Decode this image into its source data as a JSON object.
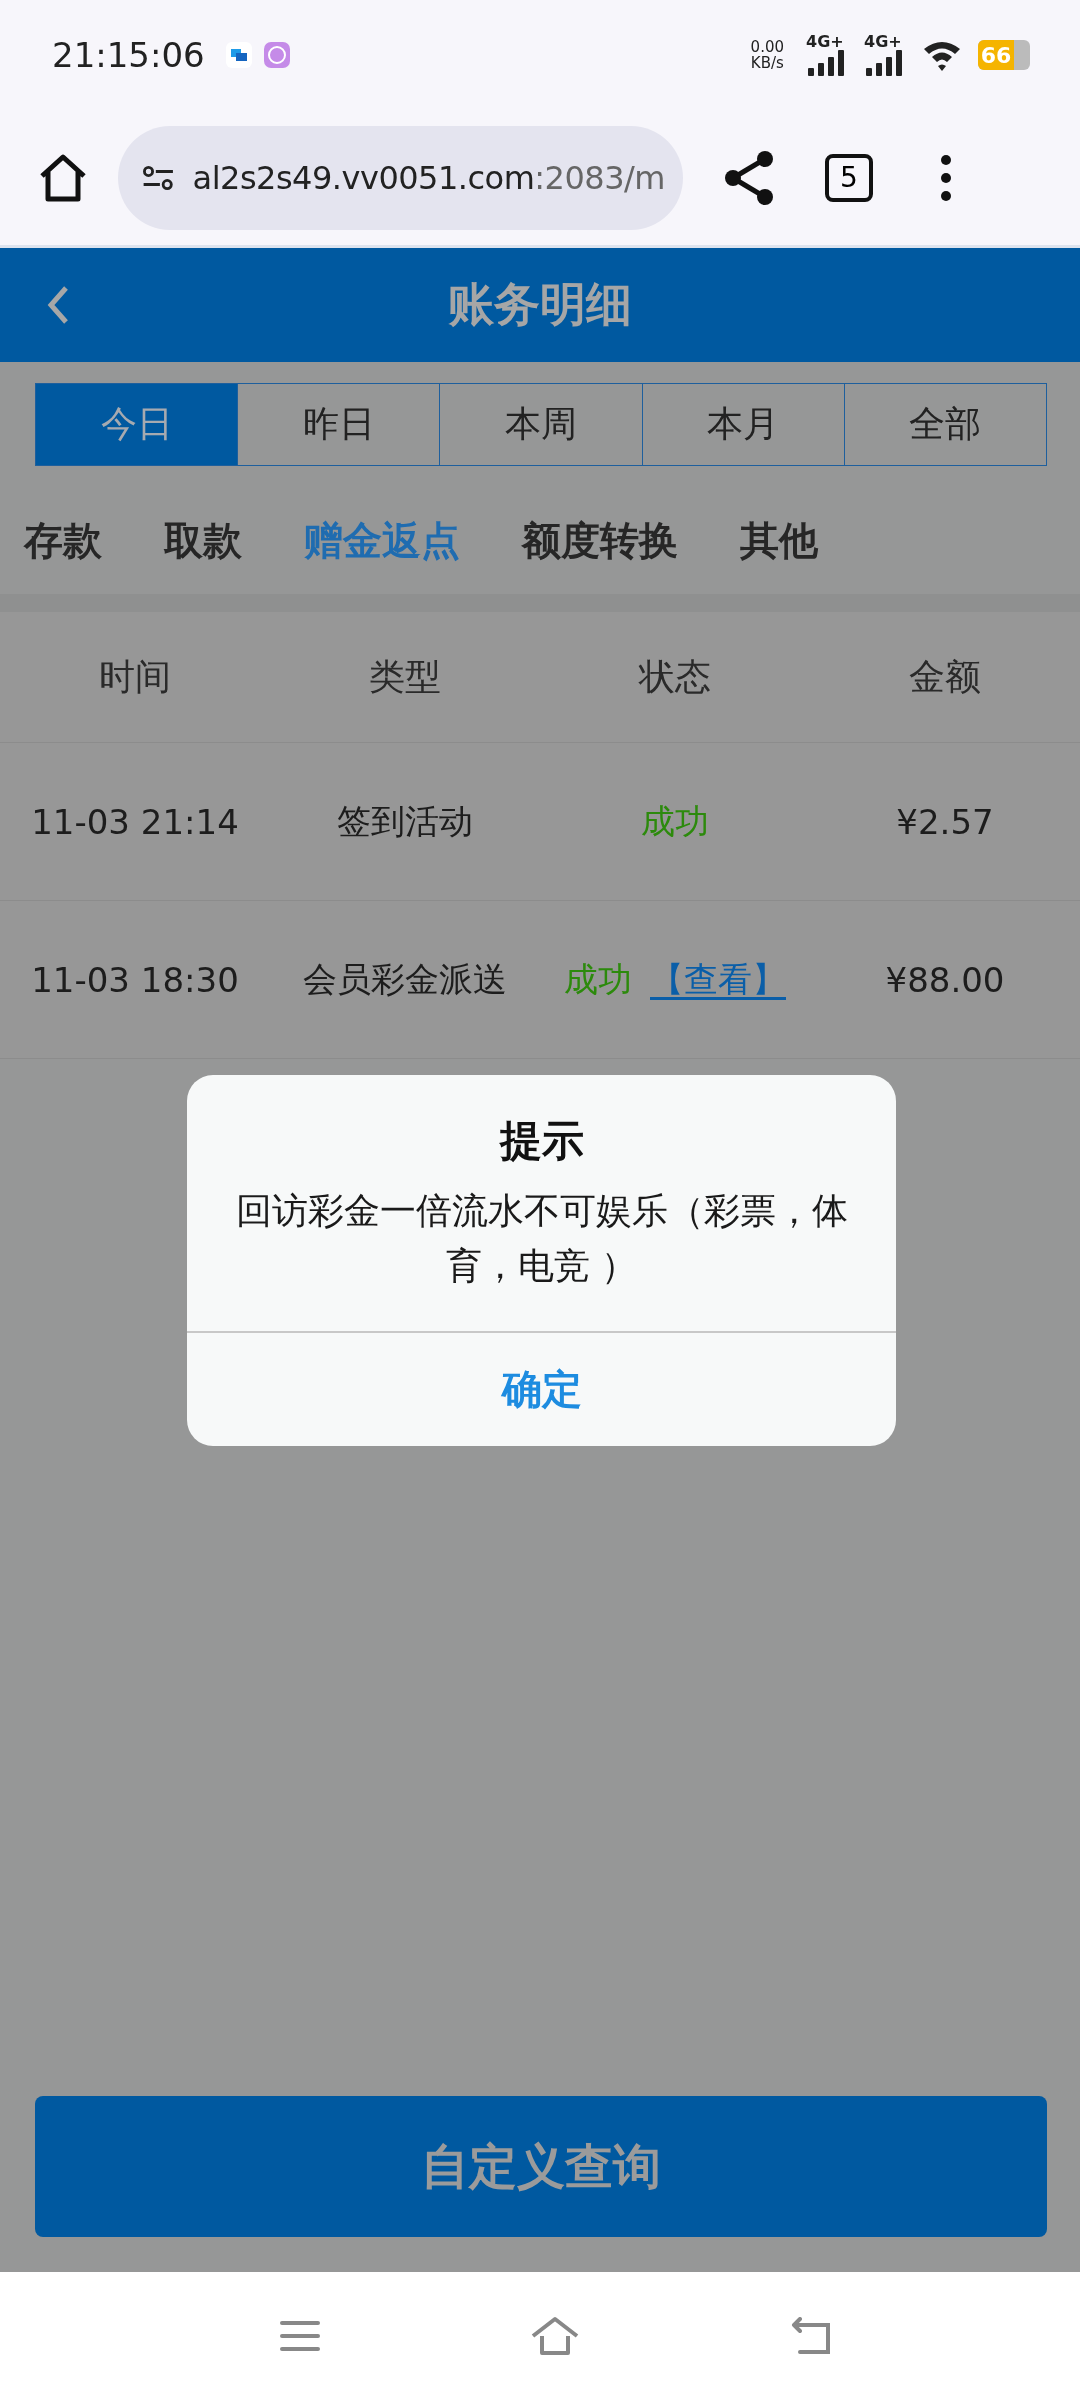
{
  "status_bar": {
    "time": "21:15:06",
    "net_speed": "0.00",
    "net_unit": "KB/s",
    "signals": [
      "4G+",
      "4G+"
    ],
    "battery": "66"
  },
  "browser": {
    "host": "al2s2s49.vv0051.com",
    "path": ":2083/m",
    "tab_count": "5"
  },
  "header": {
    "title": "账务明细"
  },
  "period_tabs": [
    {
      "label": "今日",
      "selected": true
    },
    {
      "label": "昨日",
      "selected": false
    },
    {
      "label": "本周",
      "selected": false
    },
    {
      "label": "本月",
      "selected": false
    },
    {
      "label": "全部",
      "selected": false
    }
  ],
  "categories": [
    {
      "label": "存款",
      "selected": false
    },
    {
      "label": "取款",
      "selected": false
    },
    {
      "label": "赠金返点",
      "selected": true
    },
    {
      "label": "额度转换",
      "selected": false
    },
    {
      "label": "其他",
      "selected": false
    }
  ],
  "table": {
    "columns": [
      "时间",
      "类型",
      "状态",
      "金额"
    ],
    "rows": [
      {
        "time": "11-03 21:14",
        "type": "签到活动",
        "status": "成功",
        "amount": "¥2.57"
      },
      {
        "time": "11-03 18:30",
        "type": "会员彩金派送",
        "status": "成功",
        "link": "【查看】",
        "amount": "¥88.00"
      }
    ]
  },
  "dialog": {
    "title": "提示",
    "message": "回访彩金一倍流水不可娱乐（彩票，体育，电竞 ）",
    "button": "确定"
  },
  "query_button": "自定义查询"
}
